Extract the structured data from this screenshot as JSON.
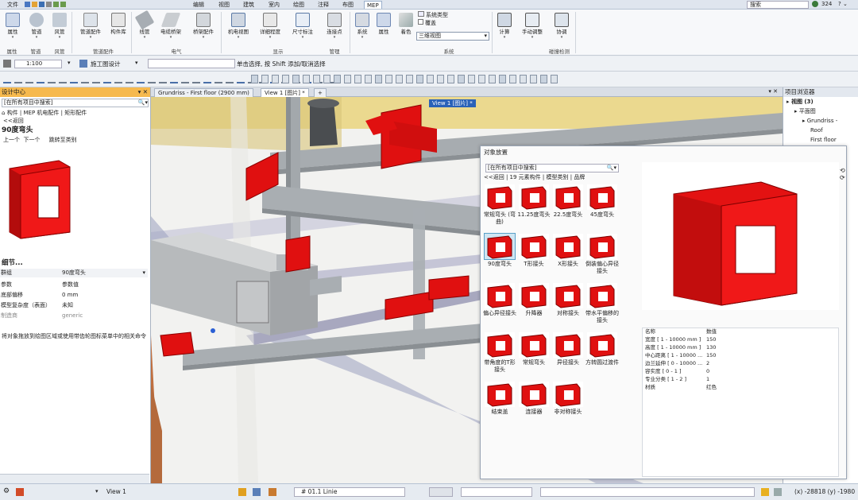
{
  "tabs": [
    {
      "label": "文件",
      "active": false
    },
    {
      "label": "编辑",
      "active": false
    },
    {
      "label": "视图",
      "active": false
    },
    {
      "label": "建筑",
      "active": false
    },
    {
      "label": "室内",
      "active": false
    },
    {
      "label": "绘图",
      "active": false
    },
    {
      "label": "注释",
      "active": false
    },
    {
      "label": "布图",
      "active": false
    },
    {
      "label": "MEP",
      "active": true
    }
  ],
  "title_search": {
    "placeholder": "搜索",
    "count": "324"
  },
  "ribbon": {
    "buttons": [
      {
        "label": "属性"
      },
      {
        "label": "管道"
      },
      {
        "label": "风管"
      },
      {
        "label": "管道配件"
      },
      {
        "label": "构件库"
      },
      {
        "label": "线管"
      },
      {
        "label": "电缆桥架"
      },
      {
        "label": "桥架配件"
      },
      {
        "label": "机电视图"
      },
      {
        "label": "详细程度"
      },
      {
        "label": "尺寸标注"
      },
      {
        "label": "连接点"
      },
      {
        "label": "系统"
      },
      {
        "label": "属性"
      },
      {
        "label": "着色"
      },
      {
        "label": "计算"
      },
      {
        "label": "手动调整"
      },
      {
        "label": "协调"
      }
    ],
    "system_type_label": "系统类型",
    "overlay_label": "覆盖",
    "view_select": "三维视图",
    "groups": [
      "属性",
      "管道",
      "风管",
      "管道配件",
      "电气",
      "显示",
      "管理",
      "系统",
      "碰撞检测"
    ]
  },
  "optbar": {
    "scale": "1:100",
    "design_mode": "施工图设计",
    "hint": "单击选择, 按 Shift 添加/取消选择"
  },
  "left_panel": {
    "title": "设计中心",
    "search": "[在所有项目中搜索]",
    "tabs": [
      "构件",
      "MEP 机电配件",
      "矩形配件"
    ],
    "back": "<<返回",
    "item_title": "90度弯头",
    "nav": {
      "prev": "上一个",
      "next": "下一个",
      "jump": "跳转至类别"
    },
    "details_title": "细节...",
    "group_label": "群组",
    "group_value": "90度弯头",
    "props": [
      {
        "k": "参数",
        "v": "参数值"
      },
      {
        "k": "底部偏移",
        "v": "0 mm"
      },
      {
        "k": "模型复杂度（表面）",
        "v": "未知"
      },
      {
        "k": "制造商",
        "v": "generic"
      }
    ],
    "hint": "将对象拖放到绘图区域或使用带齿轮图标菜单中的相关命令"
  },
  "viewport_tabs": [
    "Grundriss - First floor (2900 mm)",
    "View 1 [图片] *",
    "+"
  ],
  "viewport_label": "View 1 [图片] *",
  "right_panel": {
    "title": "项目浏览器",
    "tree": [
      {
        "label": "视图 (3)",
        "level": 0
      },
      {
        "label": "平面图",
        "level": 1
      },
      {
        "label": "Grundriss -",
        "level": 2
      },
      {
        "label": "Roof",
        "level": 3
      },
      {
        "label": "First floor",
        "level": 3
      }
    ]
  },
  "dialog": {
    "title": "对象放置",
    "search": "[在所有项目中搜索]",
    "crumbs": [
      "<<返回",
      "19 元素构件",
      "模型类别",
      "品牌"
    ],
    "items": [
      {
        "label": "常规弯头 (弯曲)"
      },
      {
        "label": "11.25度弯头"
      },
      {
        "label": "22.5度弯头"
      },
      {
        "label": "45度弯头"
      },
      {
        "label": "90度弯头",
        "selected": true
      },
      {
        "label": "T形接头"
      },
      {
        "label": "X形接头"
      },
      {
        "label": "倒装偏心异径接头"
      },
      {
        "label": "偏心异径接头"
      },
      {
        "label": "升降器"
      },
      {
        "label": "对称接头"
      },
      {
        "label": "带水平偏移的接头"
      },
      {
        "label": "带角度的T形接头"
      },
      {
        "label": "常规弯头"
      },
      {
        "label": "异径接头"
      },
      {
        "label": "方转圆过渡件"
      },
      {
        "label": "结束盖"
      },
      {
        "label": "连接器"
      },
      {
        "label": "非对称接头"
      }
    ],
    "param_header": {
      "name": "名称",
      "value": "数值"
    },
    "params": [
      {
        "name": "宽度 [ 1 - 10000 mm ]",
        "value": "150"
      },
      {
        "name": "高度 [ 1 - 10000 mm ]",
        "value": "130"
      },
      {
        "name": "中心距离 [ 1 - 10000 ...",
        "value": "150"
      },
      {
        "name": "边兰延伸 [ 0 - 10000 ...",
        "value": "2"
      },
      {
        "name": "容实度 [ 0 - 1 ]",
        "value": "0"
      },
      {
        "name": "专业分类 [ 1 - 2 ]",
        "value": "1"
      },
      {
        "name": "材质",
        "value": "红色"
      }
    ]
  },
  "status": {
    "view": "View 1",
    "line": "# 01.1 Linie",
    "coords": "(x) -28818  (y) -1980"
  },
  "colors": {
    "accent": "#f6b94e",
    "duct": "#e01010",
    "pipe": "#9ea4a8",
    "tab_blue": "#2a62b8"
  }
}
